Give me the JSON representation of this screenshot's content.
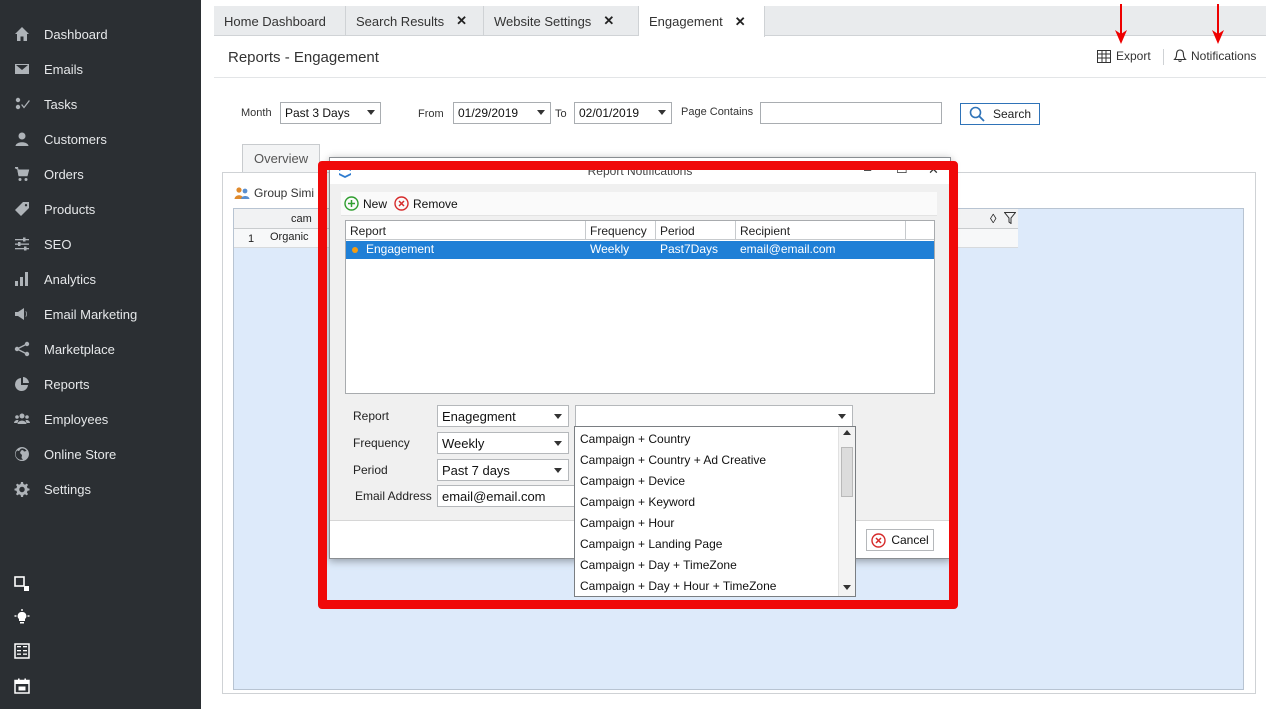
{
  "sidebar": {
    "items": [
      {
        "label": "Dashboard",
        "icon": "home-icon"
      },
      {
        "label": "Emails",
        "icon": "envelope-icon"
      },
      {
        "label": "Tasks",
        "icon": "tasks-icon"
      },
      {
        "label": "Customers",
        "icon": "user-icon"
      },
      {
        "label": "Orders",
        "icon": "cart-icon"
      },
      {
        "label": "Products",
        "icon": "tag-icon"
      },
      {
        "label": "SEO",
        "icon": "sliders-icon"
      },
      {
        "label": "Analytics",
        "icon": "bar-chart-icon"
      },
      {
        "label": "Email Marketing",
        "icon": "megaphone-icon"
      },
      {
        "label": "Marketplace",
        "icon": "share-icon"
      },
      {
        "label": "Reports",
        "icon": "pie-chart-icon"
      },
      {
        "label": "Employees",
        "icon": "group-icon"
      },
      {
        "label": "Online Store",
        "icon": "globe-icon"
      },
      {
        "label": "Settings",
        "icon": "gear-icon"
      }
    ],
    "utility_icons": [
      "windows-icon",
      "lightbulb-icon",
      "calculator-icon",
      "calendar-icon"
    ]
  },
  "tabs": [
    {
      "label": "Home Dashboard",
      "closable": false
    },
    {
      "label": "Search Results",
      "closable": true
    },
    {
      "label": "Website Settings",
      "closable": true
    },
    {
      "label": "Engagement",
      "closable": true
    }
  ],
  "tab_close_glyph": "✕",
  "page": {
    "title": "Reports - Engagement",
    "export_label": "Export",
    "notifications_label": "Notifications"
  },
  "filters": {
    "month_label": "Month",
    "month_value": "Past 3 Days",
    "from_label": "From",
    "from_value": "01/29/2019",
    "to_label": "To",
    "to_value": "02/01/2019",
    "page_contains_label": "Page Contains",
    "page_contains_value": "",
    "search_label": "Search"
  },
  "report_view": {
    "inner_tab_overview": "Overview",
    "group_by_label": "Group Simi",
    "grid_header_partial": "cam",
    "row_number": "1",
    "row_cell_partial": "Organic"
  },
  "dialog": {
    "title": "Report Notifications",
    "new_label": "New",
    "remove_label": "Remove",
    "columns": [
      "Report",
      "Frequency",
      "Period",
      "Recipient"
    ],
    "rows": [
      {
        "report": "Engagement",
        "frequency": "Weekly",
        "period": "Past7Days",
        "recipient": "email@email.com"
      }
    ],
    "form": {
      "report_label": "Report",
      "report_value": "Enagegment",
      "frequency_label": "Frequency",
      "frequency_value": "Weekly",
      "period_label": "Period",
      "period_value": "Past 7 days",
      "email_label": "Email Address",
      "email_value": "email@email.com",
      "breakdown_value": ""
    },
    "cancel_label": "Cancel"
  },
  "dropdown_options": [
    "Campaign + Country",
    "Campaign + Country + Ad Creative",
    "Campaign + Device",
    "Campaign + Keyword",
    "Campaign + Hour",
    "Campaign + Landing Page",
    "Campaign + Day + TimeZone",
    "Campaign + Day + Hour + TimeZone"
  ],
  "colors": {
    "sidebar_bg": "#2b2f33",
    "selection_blue": "#1f7fd6",
    "highlight_red": "#f00909",
    "grid_bg": "#ddeafa"
  }
}
